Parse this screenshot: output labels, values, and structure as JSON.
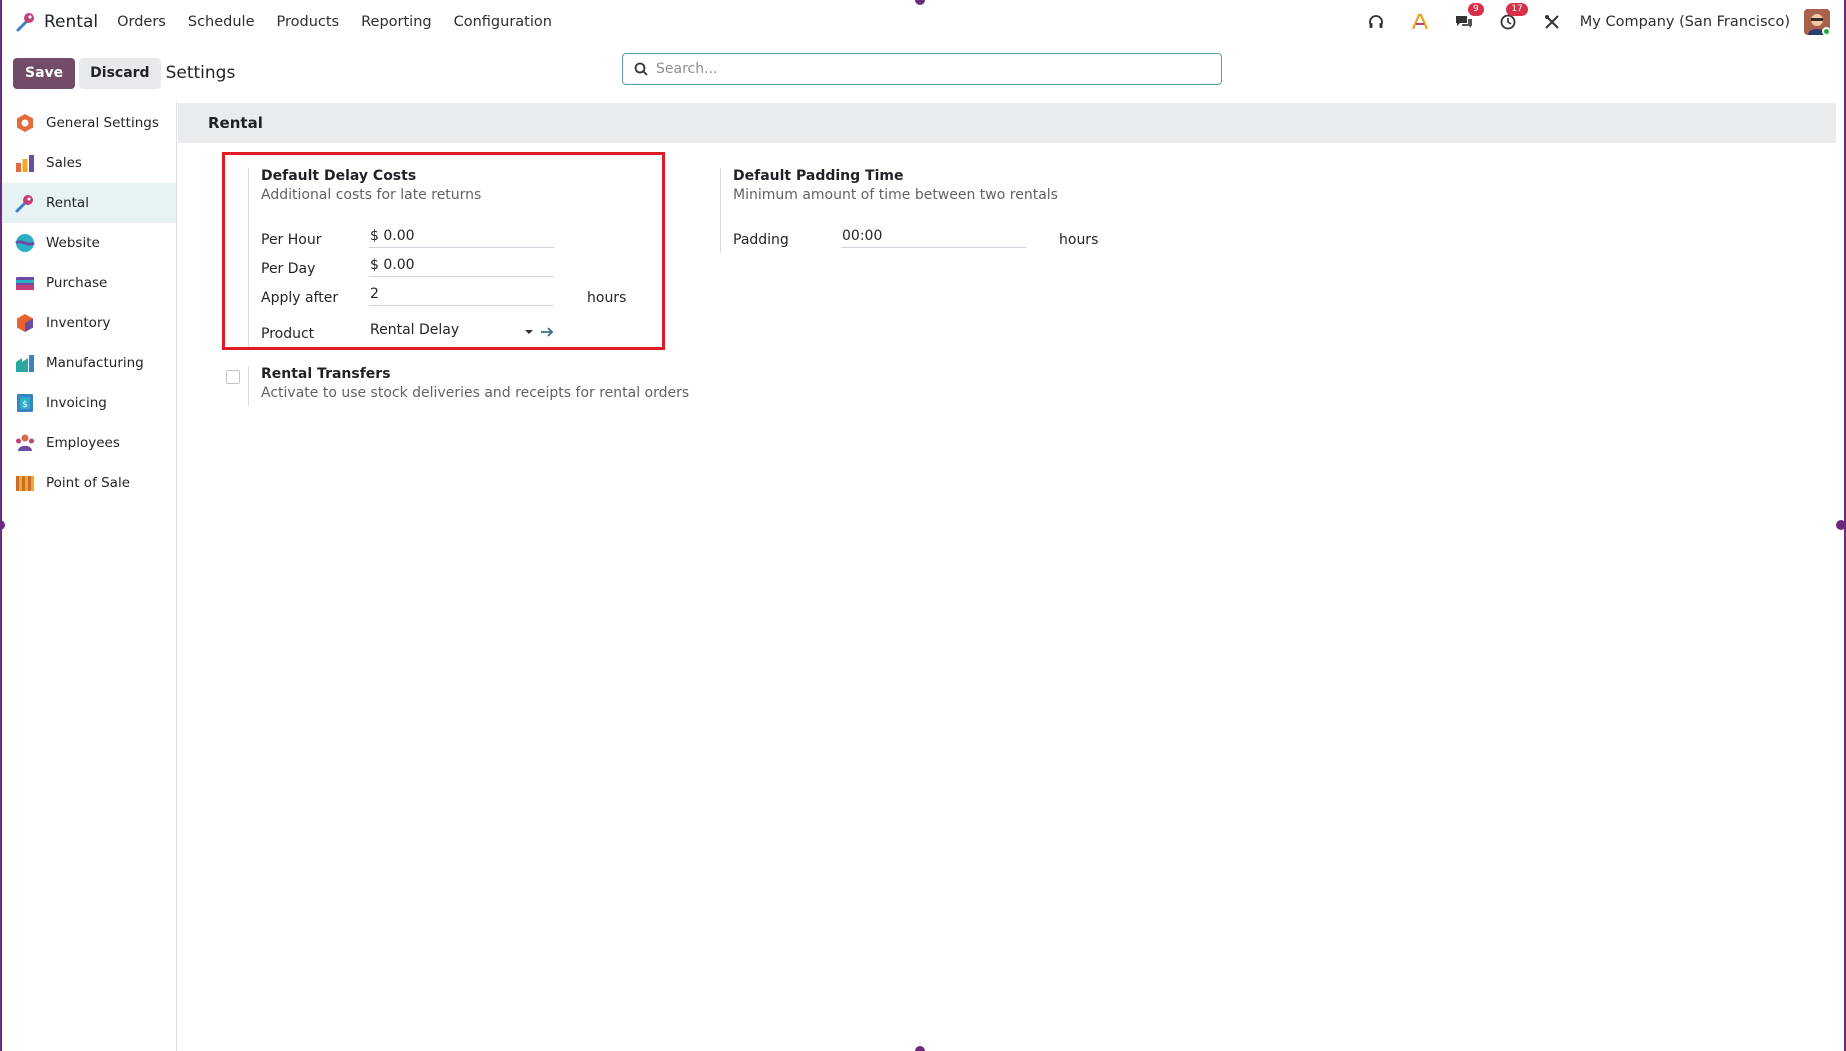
{
  "app": {
    "name": "Rental",
    "menu": [
      "Orders",
      "Schedule",
      "Products",
      "Reporting",
      "Configuration"
    ]
  },
  "nav_right": {
    "messages_count": "9",
    "activities_count": "17",
    "company": "My Company (San Francisco)"
  },
  "control": {
    "save_label": "Save",
    "discard_label": "Discard",
    "title": "Settings",
    "search_placeholder": "Search..."
  },
  "sidebar": {
    "items": [
      {
        "label": "General Settings",
        "icon": "general-settings-icon",
        "color": "#e46b3e"
      },
      {
        "label": "Sales",
        "icon": "sales-icon",
        "color": "#f5a623"
      },
      {
        "label": "Rental",
        "icon": "rental-icon",
        "color": "#5a6fd6"
      },
      {
        "label": "Website",
        "icon": "website-icon",
        "color": "#2bb0c7"
      },
      {
        "label": "Purchase",
        "icon": "purchase-icon",
        "color": "#6d4ba3"
      },
      {
        "label": "Inventory",
        "icon": "inventory-icon",
        "color": "#e8622d"
      },
      {
        "label": "Manufacturing",
        "icon": "manufacturing-icon",
        "color": "#2aa7a0"
      },
      {
        "label": "Invoicing",
        "icon": "invoicing-icon",
        "color": "#3b82c4"
      },
      {
        "label": "Employees",
        "icon": "employees-icon",
        "color": "#d96a4a"
      },
      {
        "label": "Point of Sale",
        "icon": "point-of-sale-icon",
        "color": "#c46d2f"
      }
    ],
    "active_index": 2
  },
  "section": {
    "title": "Rental"
  },
  "delay_costs": {
    "title": "Default Delay Costs",
    "description": "Additional costs for late returns",
    "per_hour_label": "Per Hour",
    "per_hour_value": "$ 0.00",
    "per_day_label": "Per Day",
    "per_day_value": "$ 0.00",
    "apply_after_label": "Apply after",
    "apply_after_value": "2",
    "apply_after_unit": "hours",
    "product_label": "Product",
    "product_value": "Rental Delay"
  },
  "padding_time": {
    "title": "Default Padding Time",
    "description": "Minimum amount of time between two rentals",
    "padding_label": "Padding",
    "padding_value": "00:00",
    "padding_unit": "hours"
  },
  "rental_transfers": {
    "title": "Rental Transfers",
    "description": "Activate to use stock deliveries and receipts for rental orders",
    "checked": false
  },
  "colors": {
    "brand": "#714b67",
    "highlight": "#e01b24",
    "active_sidebar": "#e6f2f3"
  }
}
